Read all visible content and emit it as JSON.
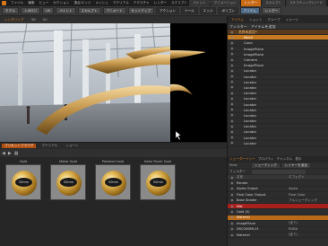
{
  "menu": {
    "items": [
      "ファイル",
      "編集",
      "ビュー",
      "セクション",
      "頂点/エッジ",
      "メッシュ",
      "マテリアル",
      "テクスチャ",
      "レンダー",
      "スクリプト",
      "システム",
      "ヘルプ"
    ],
    "layout_tabs": [
      "ペイント",
      "アニメーション",
      "レンダー",
      "スカルプト",
      "スケマティック/ノード"
    ],
    "active_layout": "レンダー"
  },
  "toolbar": {
    "buttons": [
      "モデル",
      "トポロジ",
      "UV",
      "ペイント",
      "スカルプト",
      "アニメート",
      "セットアップ"
    ],
    "mode_buttons": [
      "アクション",
      "ツール",
      "エッジ",
      "ポリゴン",
      "アイテム"
    ],
    "render_label": "レンダー"
  },
  "viewport": {
    "tabs": [
      "レンダリング",
      "3D",
      "UV"
    ],
    "active_tab": "レンダリング"
  },
  "item_list": {
    "tabs": [
      "アイテム",
      "ショット",
      "グループ",
      "イメージ"
    ],
    "active_tab": "アイテム",
    "header_items": [
      "フィルター",
      "アイテムを追加"
    ],
    "rows": [
      {
        "label": "名称未設定*",
        "kind": "scene"
      },
      {
        "label": "Mesh",
        "kind": "highlight"
      },
      {
        "label": "Cone",
        "kind": "normal"
      },
      {
        "label": "ImagePlane",
        "kind": "normal"
      },
      {
        "label": "ImagePlane",
        "kind": "normal"
      },
      {
        "label": "Camera",
        "kind": "normal"
      },
      {
        "label": "ImagePlane",
        "kind": "normal"
      },
      {
        "label": "Locator",
        "kind": "normal"
      },
      {
        "label": "Locator",
        "kind": "normal"
      },
      {
        "label": "Locator",
        "kind": "normal"
      },
      {
        "label": "Locator",
        "kind": "normal"
      },
      {
        "label": "Locator",
        "kind": "normal"
      },
      {
        "label": "Locator",
        "kind": "normal"
      },
      {
        "label": "Locator",
        "kind": "normal"
      },
      {
        "label": "Locator",
        "kind": "normal"
      },
      {
        "label": "Locator",
        "kind": "normal"
      },
      {
        "label": "Locator",
        "kind": "normal"
      },
      {
        "label": "Locator",
        "kind": "normal"
      },
      {
        "label": "Locator",
        "kind": "normal"
      },
      {
        "label": "Locator",
        "kind": "normal"
      },
      {
        "label": "Locator",
        "kind": "normal"
      }
    ]
  },
  "presets": {
    "tabs": [
      "プリセットブラウザ",
      "マテリアル",
      "ショーン"
    ],
    "active_tab": "プリセットブラウザ",
    "tiles": [
      {
        "title": "Gold",
        "disc_label": "50mm"
      },
      {
        "title": "Matte Gold",
        "disc_label": "50mm"
      },
      {
        "title": "Polished Gold",
        "disc_label": "50mm"
      },
      {
        "title": "Satin Finish Gold",
        "disc_label": "50mm"
      }
    ]
  },
  "shader_tree": {
    "tabs": [
      "シェーダーツリー",
      "プロパティ",
      "チャンネル",
      "表示"
    ],
    "active_tab": "シェーダーツリー",
    "view_label": "View",
    "view_value": "シェーディング",
    "add_button": "レイヤーを追加",
    "filter_label": "フィルター",
    "columns": [
      "名前",
      "エフェクト"
    ],
    "rows": [
      {
        "name": "Render",
        "effect": "",
        "kind": "normal"
      },
      {
        "name": "Alpha Output",
        "effect": "Alpha",
        "kind": "normal"
      },
      {
        "name": "Final Color Output",
        "effect": "Final Color",
        "kind": "normal"
      },
      {
        "name": "Base Shader",
        "effect": "フルシェーディング",
        "kind": "normal"
      },
      {
        "name": "Mat",
        "effect": "",
        "kind": "red"
      },
      {
        "name": "Gold (0)",
        "effect": "",
        "kind": "normal"
      },
      {
        "name": "Material",
        "effect": "",
        "kind": "orange"
      },
      {
        "name": "ImagePlane",
        "effect": "(全て)",
        "kind": "normal"
      },
      {
        "name": "DSC00089-01",
        "effect": "RGBA",
        "kind": "normal"
      },
      {
        "name": "Material",
        "effect": "(全て)",
        "kind": "normal"
      }
    ]
  },
  "colors": {
    "accent": "#c87a20",
    "selection_red": "#a8201c",
    "background": "#2b2b2b"
  }
}
